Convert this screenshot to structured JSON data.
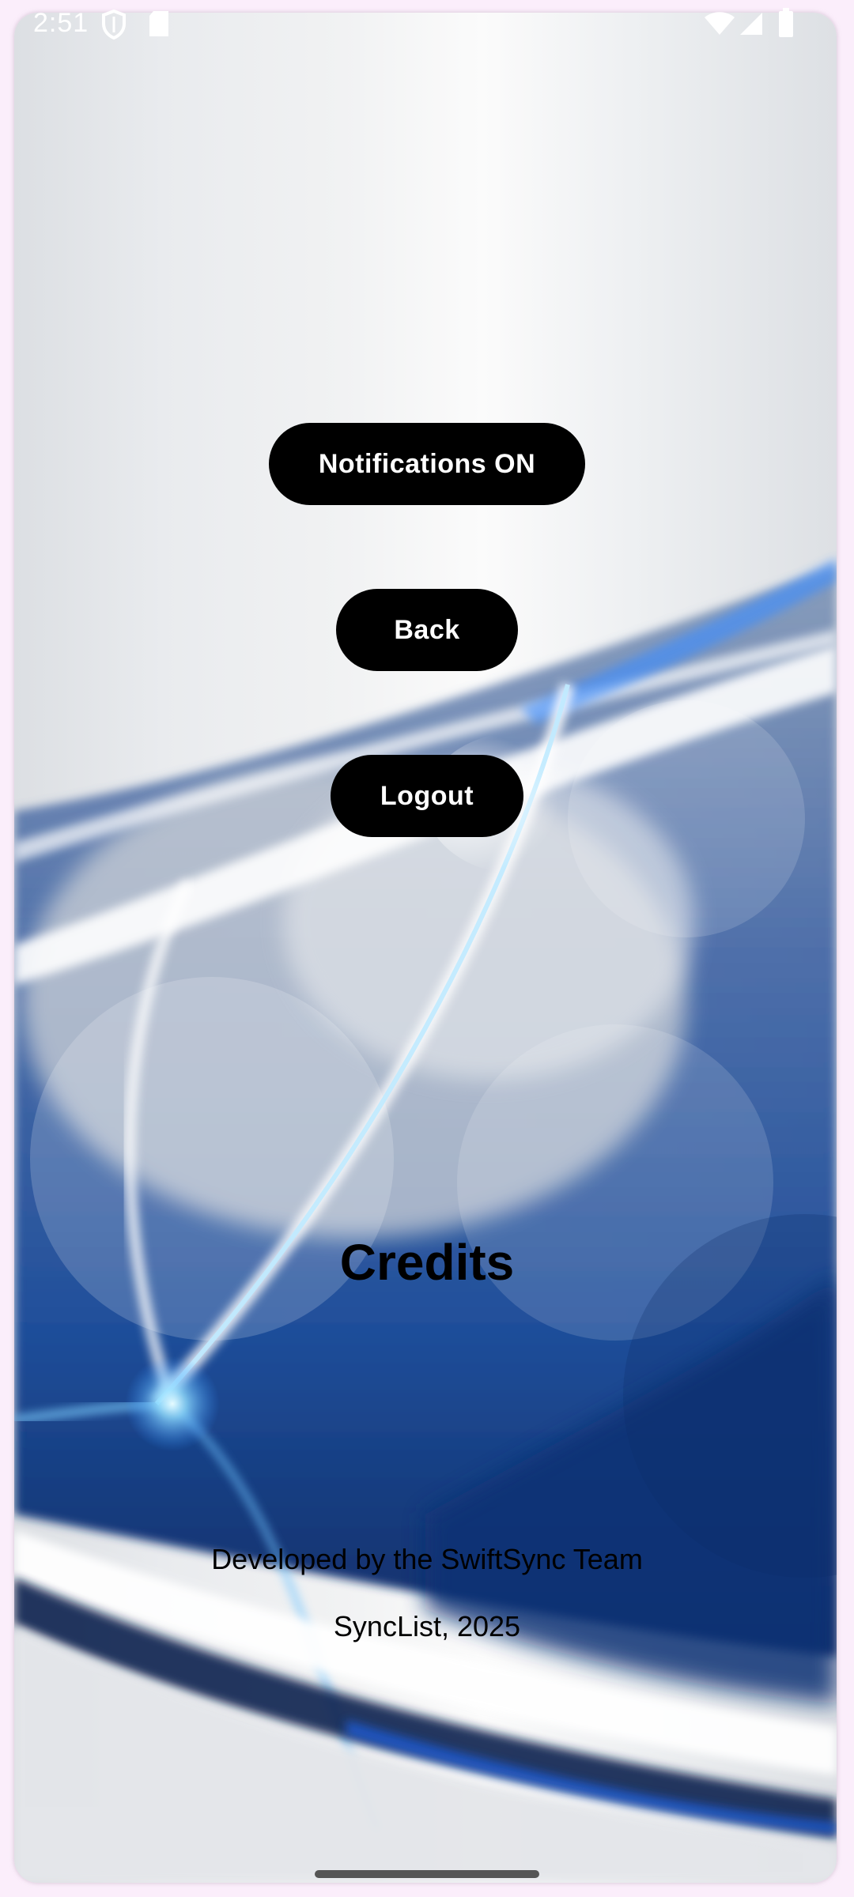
{
  "status_bar": {
    "time": "2:51",
    "icons_left": [
      "shield-icon",
      "sd-card-icon"
    ],
    "icons_right": [
      "wifi-icon",
      "cell-signal-icon",
      "battery-icon"
    ]
  },
  "buttons": {
    "notifications": "Notifications ON",
    "back": "Back",
    "logout": "Logout"
  },
  "credits": {
    "title": "Credits",
    "developer_line": "Developed by the SwiftSync Team",
    "app_line": "SyncList, 2025"
  },
  "colors": {
    "button_bg": "#000000",
    "button_text": "#ffffff",
    "accent_blue": "#1f4e9a"
  }
}
